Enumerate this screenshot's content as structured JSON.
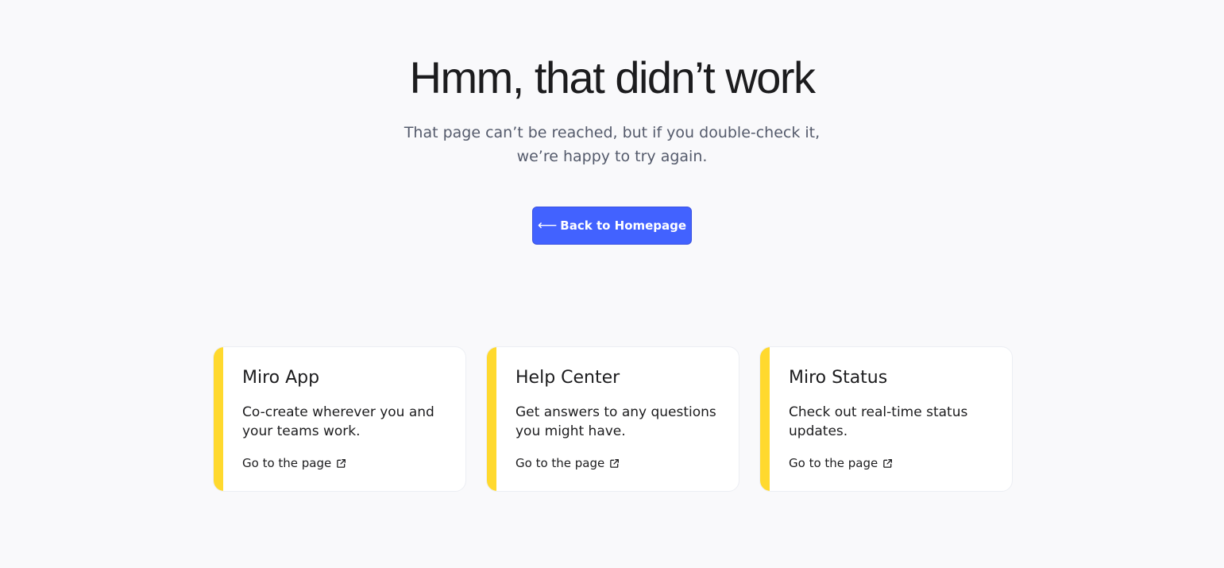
{
  "hero": {
    "title": "Hmm, that didn’t work",
    "subtitle_line1": "That page can’t be reached, but if you double-check it,",
    "subtitle_line2": "we’re happy to try again.",
    "button_arrow": "⟵",
    "button_label": "Back to Homepage"
  },
  "cards": [
    {
      "title": "Miro App",
      "description": "Co-create wherever you and your teams work.",
      "link_label": "Go to the page",
      "link_icon": "external-link-icon"
    },
    {
      "title": "Help Center",
      "description": "Get answers to any questions you might have.",
      "link_label": "Go to the page",
      "link_icon": "external-link-icon"
    },
    {
      "title": "Miro Status",
      "description": "Check out real-time status updates.",
      "link_label": "Go to the page",
      "link_icon": "external-link-icon"
    }
  ],
  "colors": {
    "background": "#f9f9fb",
    "primary_button": "#4262ff",
    "card_accent": "#ffd92e",
    "subtitle_text": "#545a6b"
  }
}
